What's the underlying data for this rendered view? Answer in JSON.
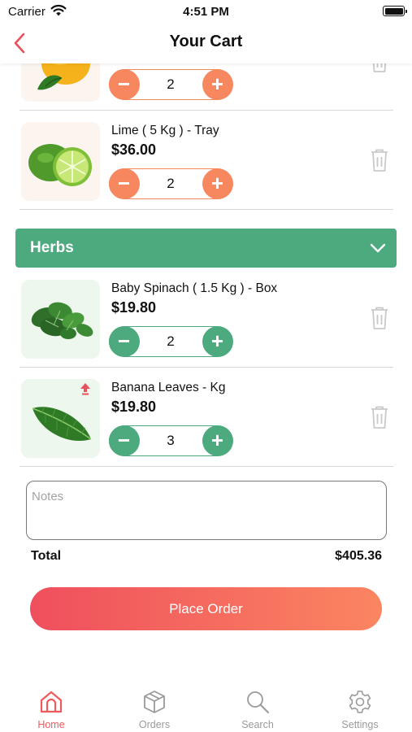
{
  "status_bar": {
    "carrier": "Carrier",
    "time": "4:51 PM"
  },
  "nav": {
    "title": "Your Cart"
  },
  "cart": {
    "items_top": [
      {
        "name": "",
        "price": "",
        "quantity": "2",
        "image": "orange-fruit"
      },
      {
        "name": "Lime ( 5 Kg ) - Tray",
        "price": "$36.00",
        "quantity": "2",
        "image": "lime"
      }
    ],
    "section": {
      "title": "Herbs",
      "color": "#4caa7e"
    },
    "items_herbs": [
      {
        "name": "Baby Spinach ( 1.5 Kg ) - Box",
        "price": "$19.80",
        "quantity": "2",
        "image": "spinach"
      },
      {
        "name": "Banana Leaves - Kg",
        "price": "$19.80",
        "quantity": "3",
        "image": "banana-leaf"
      }
    ]
  },
  "notes": {
    "placeholder": "Notes",
    "value": ""
  },
  "summary": {
    "total_label": "Total",
    "total_value": "$405.36"
  },
  "actions": {
    "place_order_label": "Place Order"
  },
  "tabs": [
    {
      "label": "Home",
      "icon": "home-icon",
      "active": true
    },
    {
      "label": "Orders",
      "icon": "box-icon",
      "active": false
    },
    {
      "label": "Search",
      "icon": "search-icon",
      "active": false
    },
    {
      "label": "Settings",
      "icon": "gear-icon",
      "active": false
    }
  ],
  "colors": {
    "accent": "#ef5a5d",
    "orange": "#f7875f",
    "green": "#4caa7e"
  }
}
